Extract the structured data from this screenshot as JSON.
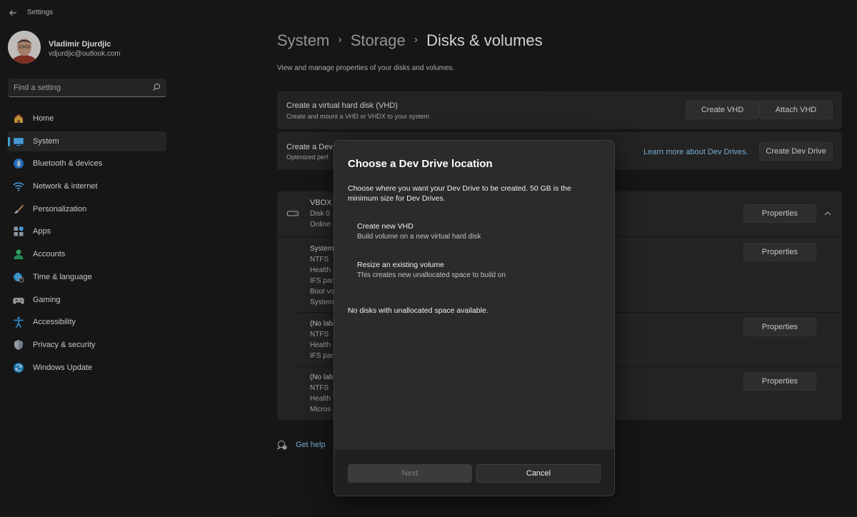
{
  "app": {
    "title": "Settings"
  },
  "user": {
    "name": "Vladimir Djurdjic",
    "email": "vdjurdjic@outlook.com"
  },
  "search": {
    "placeholder": "Find a setting"
  },
  "nav": {
    "items": [
      {
        "label": "Home",
        "icon": "home-icon",
        "selected": false
      },
      {
        "label": "System",
        "icon": "system-icon",
        "selected": true
      },
      {
        "label": "Bluetooth & devices",
        "icon": "bluetooth-icon",
        "selected": false
      },
      {
        "label": "Network & internet",
        "icon": "wifi-icon",
        "selected": false
      },
      {
        "label": "Personalization",
        "icon": "brush-icon",
        "selected": false
      },
      {
        "label": "Apps",
        "icon": "apps-icon",
        "selected": false
      },
      {
        "label": "Accounts",
        "icon": "person-icon",
        "selected": false
      },
      {
        "label": "Time & language",
        "icon": "globe-clock-icon",
        "selected": false
      },
      {
        "label": "Gaming",
        "icon": "gamepad-icon",
        "selected": false
      },
      {
        "label": "Accessibility",
        "icon": "accessibility-icon",
        "selected": false
      },
      {
        "label": "Privacy & security",
        "icon": "shield-icon",
        "selected": false
      },
      {
        "label": "Windows Update",
        "icon": "update-icon",
        "selected": false
      }
    ]
  },
  "breadcrumb": {
    "part1": "System",
    "part2": "Storage",
    "current": "Disks & volumes"
  },
  "subtitle": "View and manage properties of your disks and volumes.",
  "vhd_card": {
    "title": "Create a virtual hard disk (VHD)",
    "desc": "Create and mount a VHD or VHDX to your system",
    "create_btn": "Create VHD",
    "attach_btn": "Attach VHD"
  },
  "dev_card": {
    "title": "Create a Dev",
    "desc": "Optimized perf",
    "link": "Learn more about Dev Drives.",
    "create_btn": "Create Dev Drive"
  },
  "disk": {
    "name": "VBOX I",
    "line2": "Disk 0",
    "line3": "Online",
    "properties_btn": "Properties"
  },
  "volumes": [
    {
      "lines": [
        "System",
        "NTFS",
        "Health",
        "IFS par",
        "Boot vo",
        "System"
      ],
      "properties_btn": "Properties"
    },
    {
      "lines": [
        "(No lab",
        "NTFS",
        "Health",
        "IFS par"
      ],
      "properties_btn": "Properties"
    },
    {
      "lines": [
        "(No lab",
        "NTFS",
        "Health",
        "Micros"
      ],
      "properties_btn": "Properties"
    }
  ],
  "get_help": "Get help",
  "dialog": {
    "title": "Choose a Dev Drive location",
    "message": "Choose where you want your Dev Drive to be created. 50 GB is the minimum size for Dev Drives.",
    "options": [
      {
        "title": "Create new VHD",
        "desc": "Build volume on a new virtual hard disk"
      },
      {
        "title": "Resize an existing volume",
        "desc": "This creates new unallocated space to build on"
      }
    ],
    "note": "No disks with unallocated space available.",
    "next_btn": "Next",
    "cancel_btn": "Cancel"
  },
  "colors": {
    "accent": "#4cc2ff",
    "link": "#8ed0ff",
    "background": "#1c1c1c",
    "card": "#2b2b2b"
  }
}
